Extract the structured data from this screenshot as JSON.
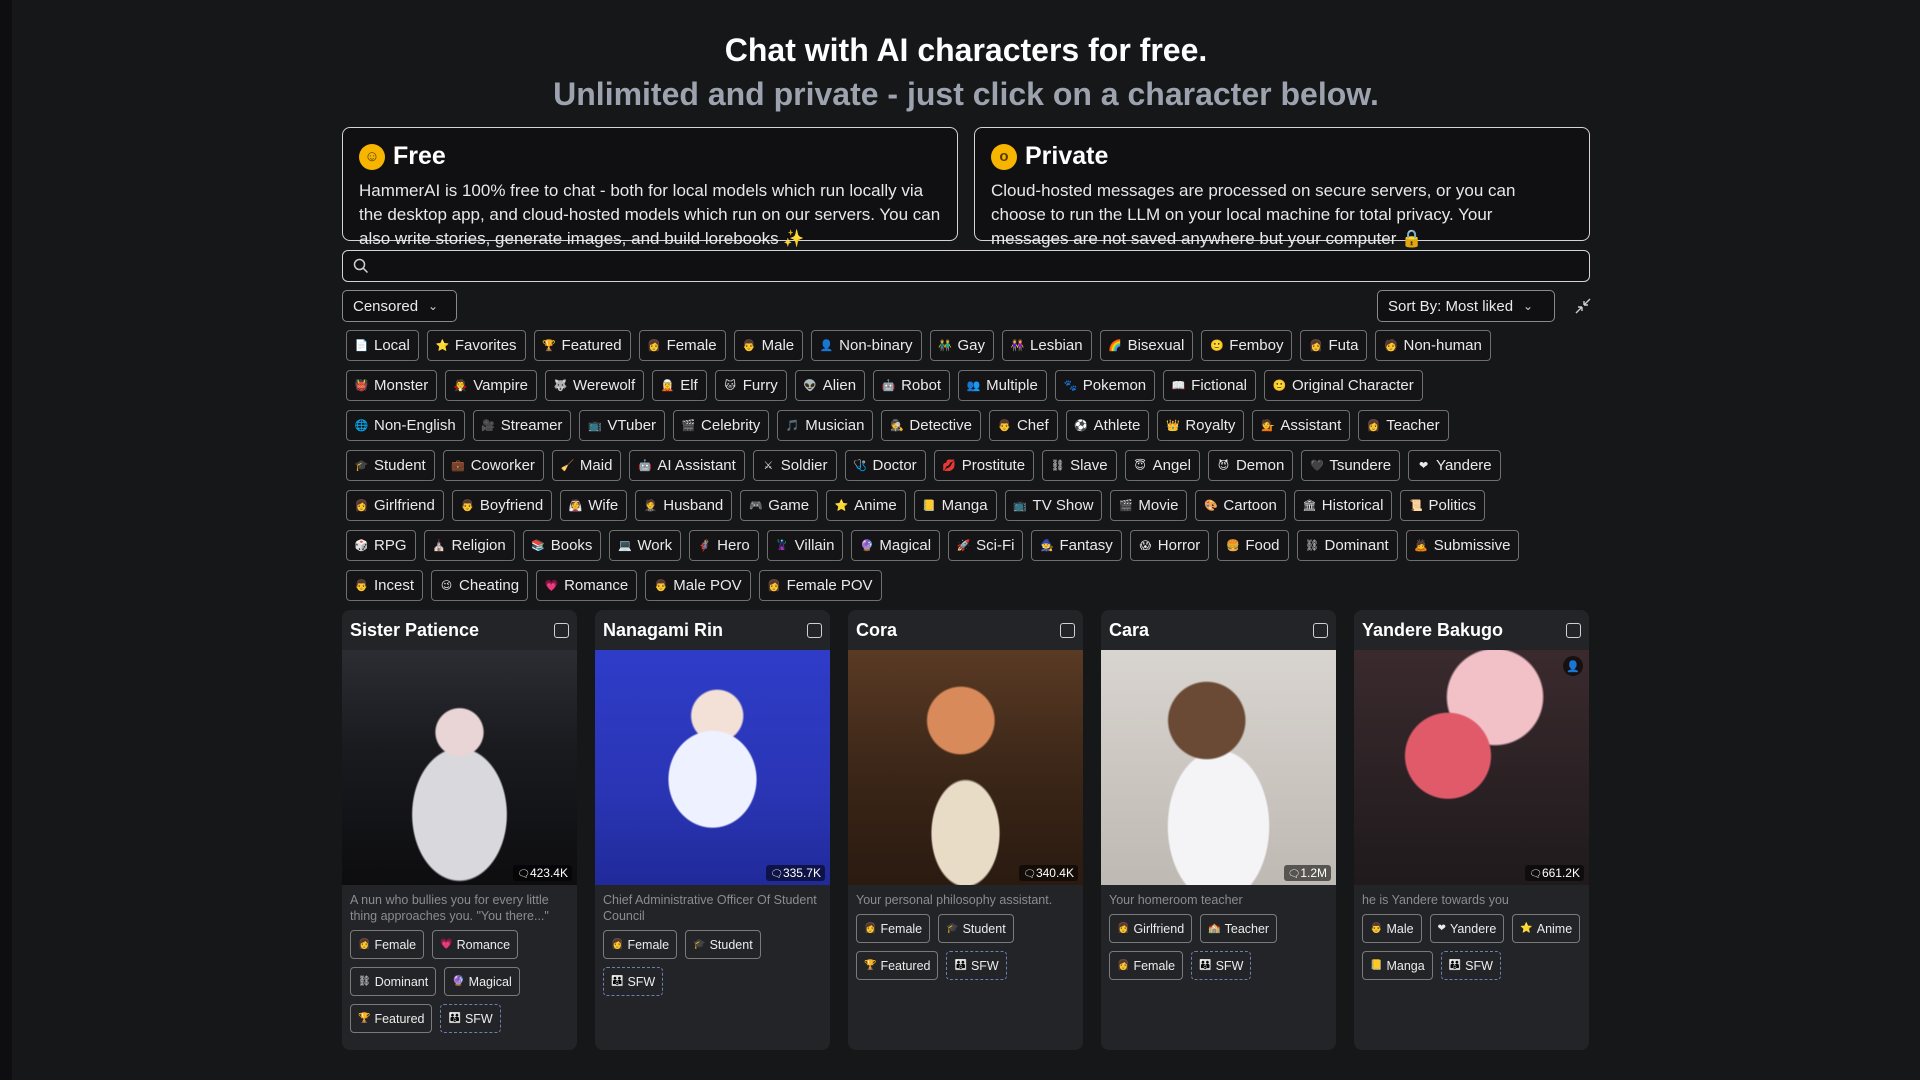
{
  "hero": {
    "title": "Chat with AI characters for free.",
    "subtitle": "Unlimited and private - just click on a character below."
  },
  "info_cards": [
    {
      "icon": "smiling-face-icon",
      "title": "Free",
      "body": "HammerAI is 100% free to chat - both for local models which run locally via the desktop app, and cloud-hosted models which run on our servers. You can also write stories, generate images, and build lorebooks ✨"
    },
    {
      "icon": "hushed-face-icon",
      "title": "Private",
      "body": "Cloud-hosted messages are processed on secure servers, or you can choose to run the LLM on your local machine for total privacy. Your messages are not saved anywhere but your computer 🔒"
    }
  ],
  "search": {
    "placeholder": ""
  },
  "filter": {
    "content": "Censored",
    "sort": "Sort By: Most liked"
  },
  "tag_rows": [
    [
      "Local",
      "Favorites",
      "Featured",
      "Female",
      "Male",
      "Non-binary",
      "Gay",
      "Lesbian",
      "Bisexual",
      "Femboy",
      "Futa",
      "Non-human"
    ],
    [
      "Monster",
      "Vampire",
      "Werewolf",
      "Elf",
      "Furry",
      "Alien",
      "Robot",
      "Multiple",
      "Pokemon",
      "Fictional",
      "Original Character"
    ],
    [
      "Non-English",
      "Streamer",
      "VTuber",
      "Celebrity",
      "Musician",
      "Detective",
      "Chef",
      "Athlete",
      "Royalty",
      "Assistant",
      "Teacher"
    ],
    [
      "Student",
      "Coworker",
      "Maid",
      "AI Assistant",
      "Soldier",
      "Doctor",
      "Prostitute",
      "Slave",
      "Angel",
      "Demon",
      "Tsundere",
      "Yandere"
    ],
    [
      "Girlfriend",
      "Boyfriend",
      "Wife",
      "Husband",
      "Game",
      "Anime",
      "Manga",
      "TV Show",
      "Movie",
      "Cartoon",
      "Historical",
      "Politics"
    ],
    [
      "RPG",
      "Religion",
      "Books",
      "Work",
      "Hero",
      "Villain",
      "Magical",
      "Sci-Fi",
      "Fantasy",
      "Horror",
      "Food",
      "Dominant",
      "Submissive"
    ],
    [
      "Incest",
      "Cheating",
      "Romance",
      "Male POV",
      "Female POV"
    ]
  ],
  "tag_icons": [
    [
      "📄",
      "⭐",
      "🏆",
      "👩",
      "👨",
      "👤",
      "👬",
      "👭",
      "🌈",
      "🙂",
      "👩",
      "🧑"
    ],
    [
      "👹",
      "🧛",
      "🐺",
      "🧝",
      "🐱",
      "👽",
      "🤖",
      "👥",
      "🐾",
      "📖",
      "🙂"
    ],
    [
      "🌐",
      "🎥",
      "📺",
      "🎬",
      "🎵",
      "🕵",
      "👨",
      "⚽",
      "👑",
      "💁",
      "👩"
    ],
    [
      "🎓",
      "💼",
      "🧹",
      "🤖",
      "⚔",
      "🩺",
      "💋",
      "⛓",
      "😇",
      "😈",
      "🖤",
      "❤"
    ],
    [
      "👩",
      "👨",
      "👰",
      "🤵",
      "🎮",
      "⭐",
      "📒",
      "📺",
      "🎬",
      "🎨",
      "🏛",
      "📜"
    ],
    [
      "🎲",
      "⛪",
      "📚",
      "💻",
      "🦸",
      "🦹",
      "🔮",
      "🚀",
      "🧙",
      "😱",
      "🍔",
      "⛓",
      "🙇"
    ],
    [
      "👨",
      "😉",
      "💗",
      "👨",
      "👩"
    ]
  ],
  "characters": [
    {
      "name": "Sister Patience",
      "count": "423.4K",
      "desc": "A nun who bullies you for every little thing approaches you. \"You there...\"",
      "tags": [
        {
          "label": "Female",
          "icon": "👩"
        },
        {
          "label": "Romance",
          "icon": "💗"
        },
        {
          "label": "Dominant",
          "icon": "⛓"
        },
        {
          "label": "Magical",
          "icon": "🔮"
        },
        {
          "label": "Featured",
          "icon": "🏆"
        },
        {
          "label": "SFW",
          "icon": "👪",
          "dashed": true
        }
      ]
    },
    {
      "name": "Nanagami Rin",
      "count": "335.7K",
      "desc": "Chief Administrative Officer Of Student Council",
      "tags": [
        {
          "label": "Female",
          "icon": "👩"
        },
        {
          "label": "Student",
          "icon": "🎓"
        },
        {
          "label": "SFW",
          "icon": "👪",
          "dashed": true
        }
      ]
    },
    {
      "name": "Cora",
      "count": "340.4K",
      "desc": "Your personal philosophy assistant.",
      "tags": [
        {
          "label": "Female",
          "icon": "👩"
        },
        {
          "label": "Student",
          "icon": "🎓"
        },
        {
          "label": "Featured",
          "icon": "🏆"
        },
        {
          "label": "SFW",
          "icon": "👪",
          "dashed": true
        }
      ]
    },
    {
      "name": "Cara",
      "count": "1.2M",
      "desc": "Your homeroom teacher",
      "tags": [
        {
          "label": "Girlfriend",
          "icon": "👩"
        },
        {
          "label": "Teacher",
          "icon": "🏫"
        },
        {
          "label": "Female",
          "icon": "👩"
        },
        {
          "label": "SFW",
          "icon": "👪",
          "dashed": true
        }
      ]
    },
    {
      "name": "Yandere Bakugo",
      "count": "661.2K",
      "desc": "he is Yandere towards you",
      "tags": [
        {
          "label": "Male",
          "icon": "👨"
        },
        {
          "label": "Yandere",
          "icon": "❤"
        },
        {
          "label": "Anime",
          "icon": "⭐"
        },
        {
          "label": "Manga",
          "icon": "📒"
        },
        {
          "label": "SFW",
          "icon": "👪",
          "dashed": true
        }
      ]
    }
  ]
}
